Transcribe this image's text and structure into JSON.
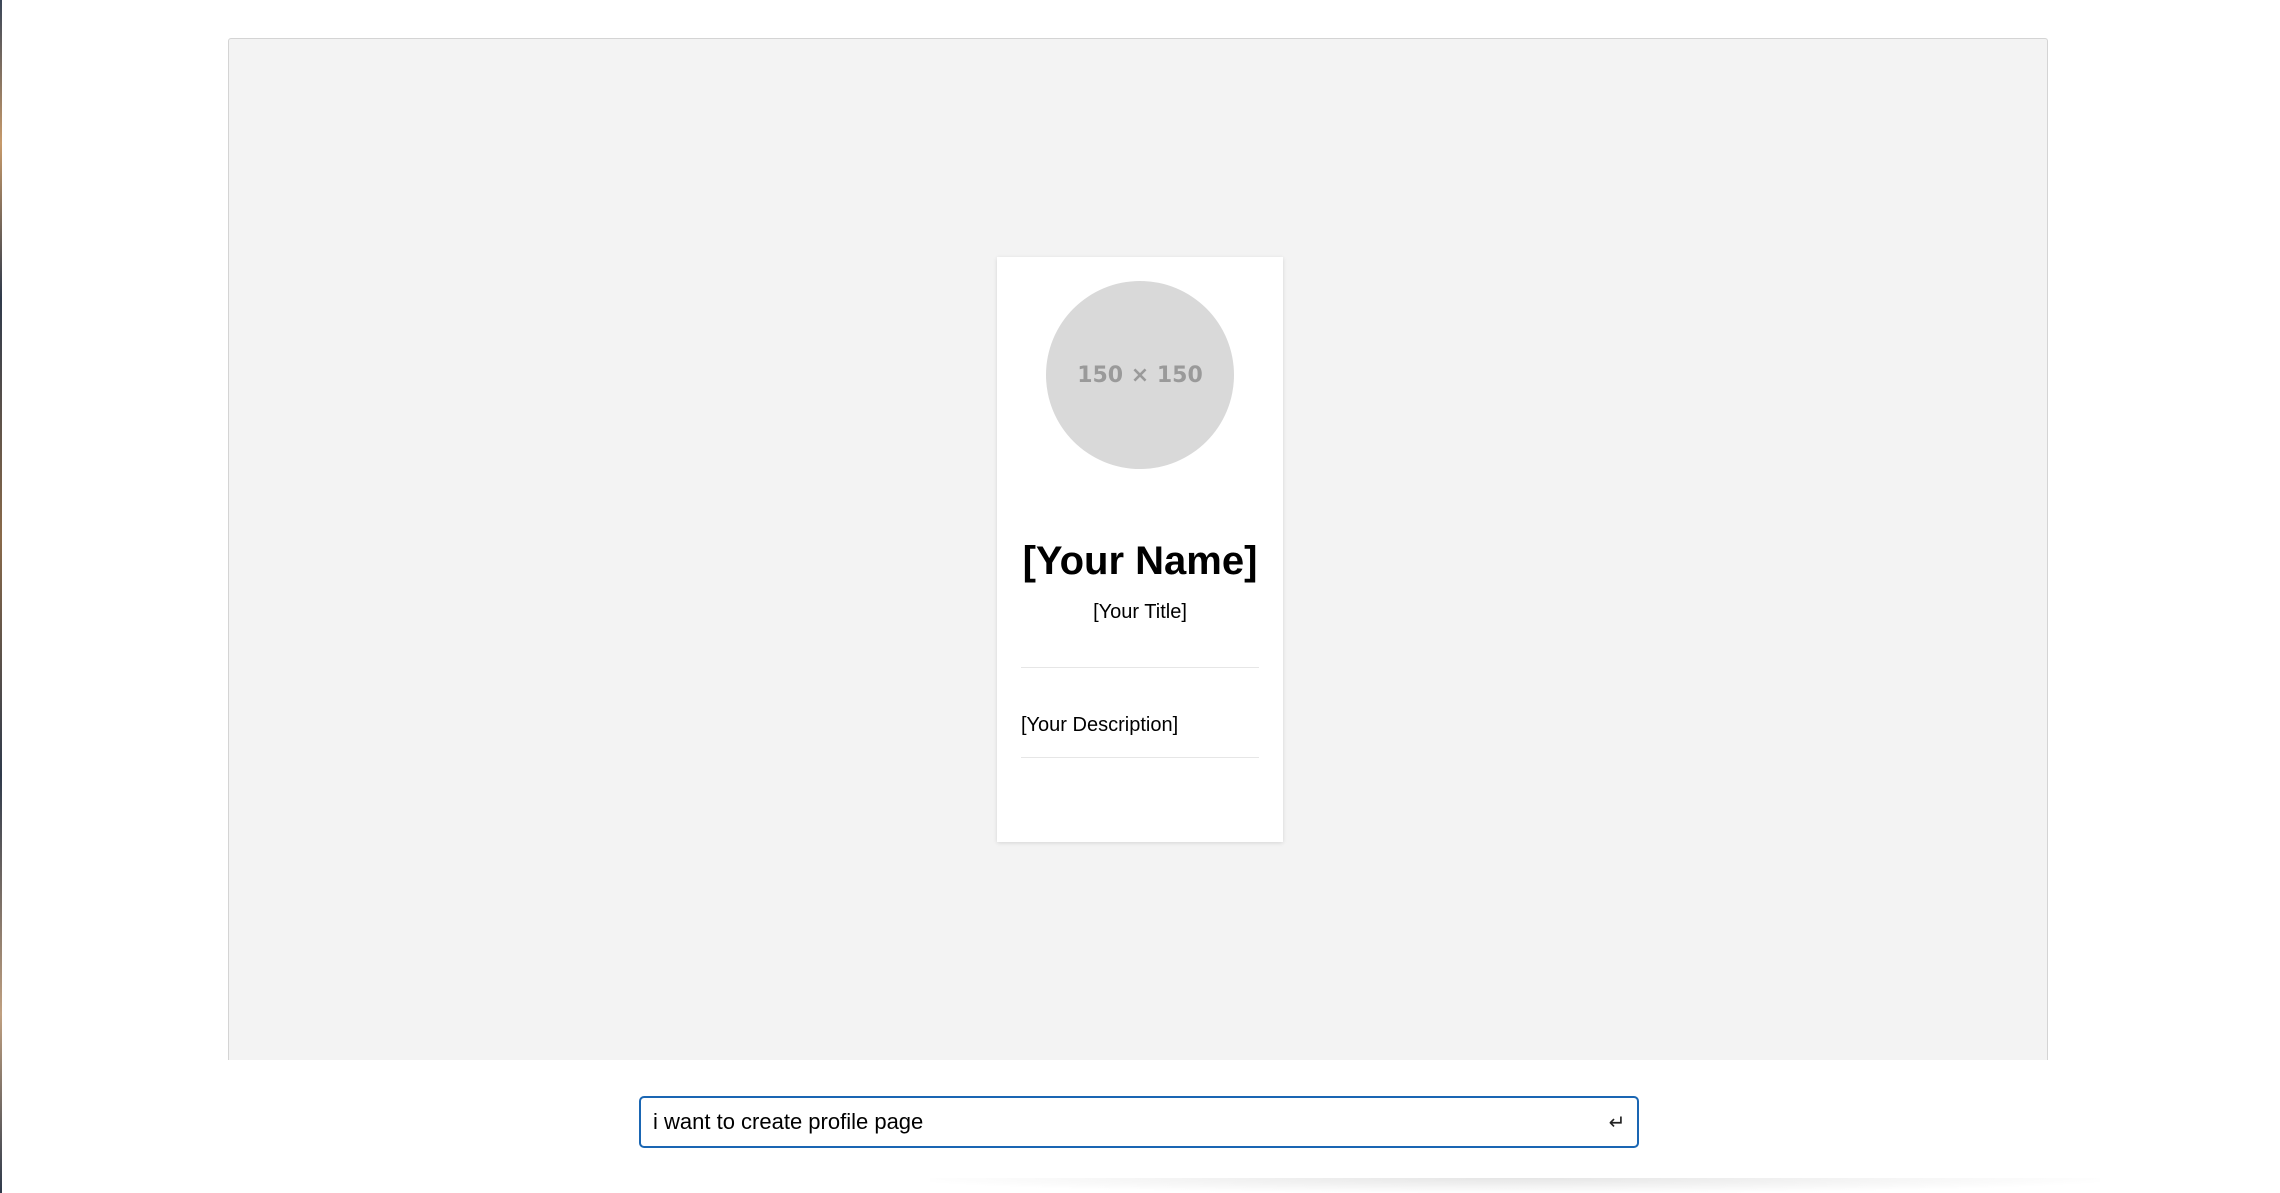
{
  "preview": {
    "profile": {
      "avatar_placeholder": "150 × 150",
      "name": "[Your Name]",
      "title": "[Your Title]",
      "description": "[Your Description]"
    }
  },
  "prompt": {
    "value": "i want to create profile page",
    "submit_icon": "↵"
  },
  "colors": {
    "preview_background": "#f3f3f3",
    "card_background": "#ffffff",
    "avatar_fill": "#d9d9d9",
    "prompt_border": "#1a66b3"
  },
  "icons": {
    "submit": "enter-icon"
  }
}
